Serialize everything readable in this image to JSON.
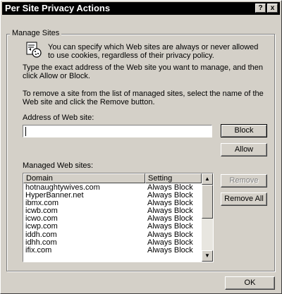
{
  "window": {
    "title": "Per Site Privacy Actions",
    "help_glyph": "?",
    "close_glyph": "x"
  },
  "group": {
    "legend": "Manage Sites",
    "intro": "You can specify which Web sites are always or never allowed to use cookies, regardless of their privacy policy.",
    "para1": "Type the exact address of the Web site you want to manage, and then click Allow or Block.",
    "para2": "To remove a site from the list of managed sites, select the name of the Web site and click the Remove button.",
    "address_label": "Address of Web site:",
    "address_value": "",
    "managed_label": "Managed Web sites:"
  },
  "buttons": {
    "block": "Block",
    "allow": "Allow",
    "remove": "Remove",
    "remove_all": "Remove All",
    "ok": "OK"
  },
  "list": {
    "columns": [
      "Domain",
      "Setting"
    ],
    "rows": [
      {
        "domain": "hotnaughtywives.com",
        "setting": "Always Block"
      },
      {
        "domain": "HyperBanner.net",
        "setting": "Always Block"
      },
      {
        "domain": "ibmx.com",
        "setting": "Always Block"
      },
      {
        "domain": "icwb.com",
        "setting": "Always Block"
      },
      {
        "domain": "icwo.com",
        "setting": "Always Block"
      },
      {
        "domain": "icwp.com",
        "setting": "Always Block"
      },
      {
        "domain": "iddh.com",
        "setting": "Always Block"
      },
      {
        "domain": "idhh.com",
        "setting": "Always Block"
      },
      {
        "domain": "ifix.com",
        "setting": "Always Block"
      }
    ],
    "scroll_up_glyph": "▲",
    "scroll_down_glyph": "▼"
  },
  "icons": {
    "info": "cookie-privacy-icon"
  }
}
